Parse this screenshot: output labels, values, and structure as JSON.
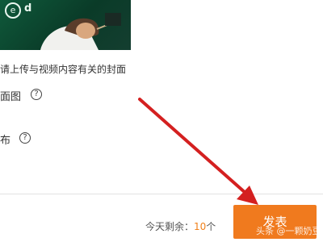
{
  "cover": {
    "logo_glyph": "e",
    "logo_text": "d"
  },
  "cover_hint": "请上传与视频内容有关的封面",
  "rows": [
    {
      "label": "面图",
      "help_glyph": "?"
    },
    {
      "label": "布",
      "help_glyph": "?"
    }
  ],
  "footer": {
    "remain_label": "今天剩余：",
    "remain_count": "10",
    "remain_unit": "个",
    "publish_label": "发表"
  },
  "watermark": "头条 @一颗奶豆",
  "colors": {
    "accent": "#f07a1e",
    "arrow": "#d42020"
  }
}
